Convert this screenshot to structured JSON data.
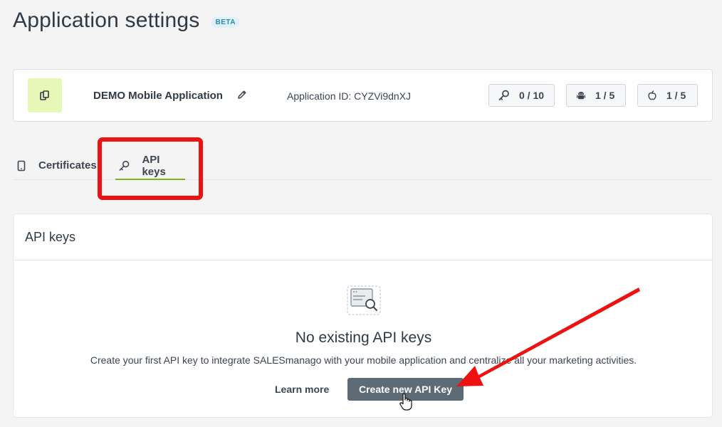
{
  "page": {
    "title": "Application settings",
    "badge": "BETA"
  },
  "app": {
    "name": "DEMO Mobile Application",
    "id_text": "Application ID: CYZVi9dnXJ",
    "stats": {
      "api_keys": "0 / 10",
      "android": "1 / 5",
      "ios": "1 / 5"
    },
    "icon_bg": "#e6f7b8"
  },
  "tabs": [
    {
      "label": "Certificates",
      "icon": "mobile-icon",
      "active": false
    },
    {
      "label": "API keys",
      "icon": "key-icon",
      "active": true
    }
  ],
  "api_card": {
    "header": "API keys",
    "empty_title": "No existing API keys",
    "empty_desc": "Create your first API key to integrate SALESmanago with your mobile application and centralize all your marketing activities.",
    "learn_more": "Learn more",
    "create_button": "Create new API Key"
  },
  "colors": {
    "accent_underline": "#7bb51c",
    "primary_button": "#5d6b77",
    "annotation_red": "#ee1111"
  }
}
